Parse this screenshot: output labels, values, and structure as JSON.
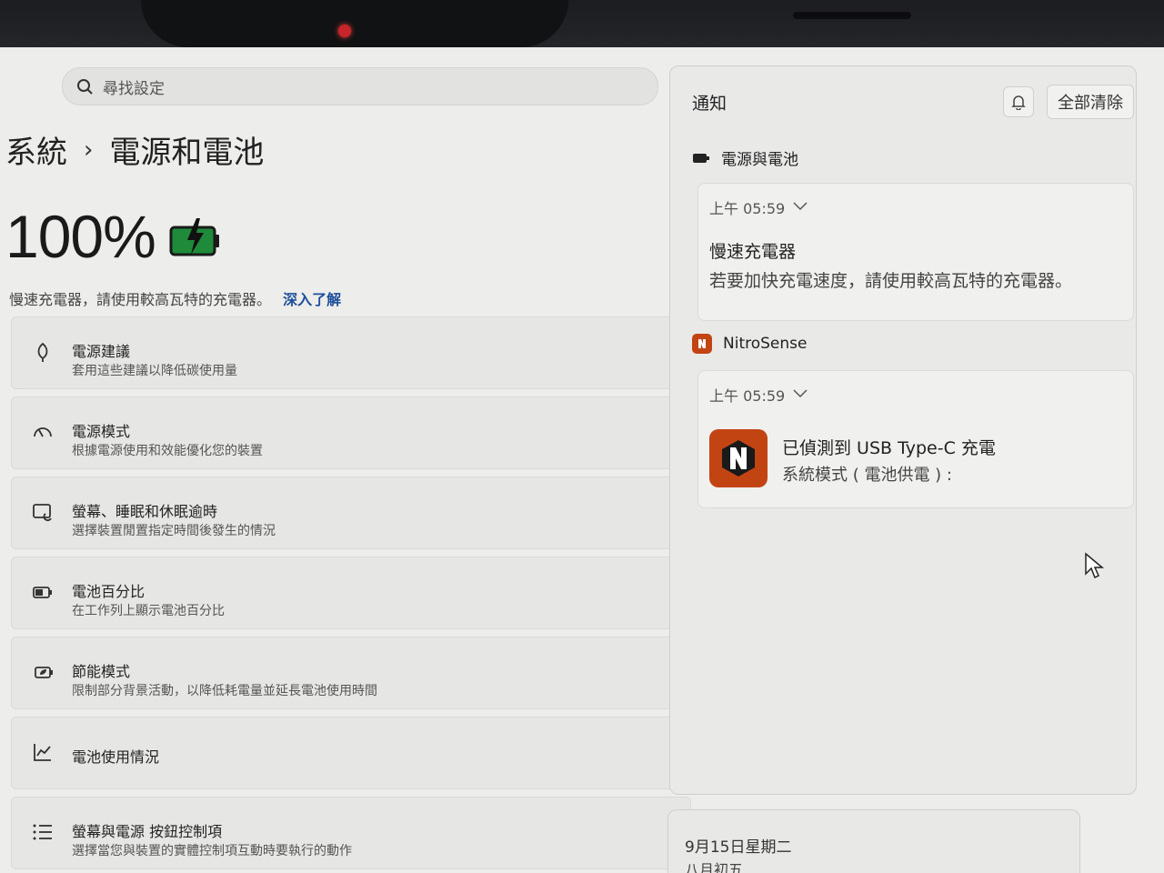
{
  "search": {
    "placeholder": "尋找設定"
  },
  "breadcrumb": {
    "parent": "系統",
    "separator": "›",
    "current": "電源和電池"
  },
  "battery": {
    "percent_label": "100%",
    "level": 1.0,
    "charging": true,
    "color": "#1f8a3a"
  },
  "hint": {
    "text": "慢速充電器，請使用較高瓦特的充電器。",
    "link": "深入了解"
  },
  "settings_items": [
    {
      "icon": "leaf-icon",
      "title": "電源建議",
      "subtitle": "套用這些建議以降低碳使用量"
    },
    {
      "icon": "speedometer-icon",
      "title": "電源模式",
      "subtitle": "根據電源使用和效能優化您的裝置"
    },
    {
      "icon": "sleep-screen-icon",
      "title": "螢幕、睡眠和休眠逾時",
      "subtitle": "選擇裝置閒置指定時間後發生的情況"
    },
    {
      "icon": "battery-percent-icon",
      "title": "電池百分比",
      "subtitle": "在工作列上顯示電池百分比"
    },
    {
      "icon": "energy-saver-icon",
      "title": "節能模式",
      "subtitle": "限制部分背景活動，以降低耗電量並延長電池使用時間"
    },
    {
      "icon": "usage-chart-icon",
      "title": "電池使用情況",
      "subtitle": ""
    },
    {
      "icon": "list-controls-icon",
      "title": "螢幕與電源 按鈕控制項",
      "subtitle": "選擇當您與裝置的實體控制項互動時要執行的動作"
    }
  ],
  "notifications": {
    "title": "通知",
    "clear_all": "全部清除",
    "groups": [
      {
        "app": "電源與電池",
        "time": "上午 05:59",
        "title": "慢速充電器",
        "body": "若要加快充電速度，請使用較高瓦特的充電器。"
      },
      {
        "app": "NitroSense",
        "time": "上午 05:59",
        "title": "已偵測到 USB Type-C 充電",
        "body": "系統模式 ( 電池供電 ) :"
      }
    ]
  },
  "calendar": {
    "date": "9月15日星期二",
    "lunar": "八月初五"
  },
  "colors": {
    "accent_link": "#1e4f9a",
    "nitrosense_brand": "#c34413",
    "camera_led": "#c8242b"
  }
}
